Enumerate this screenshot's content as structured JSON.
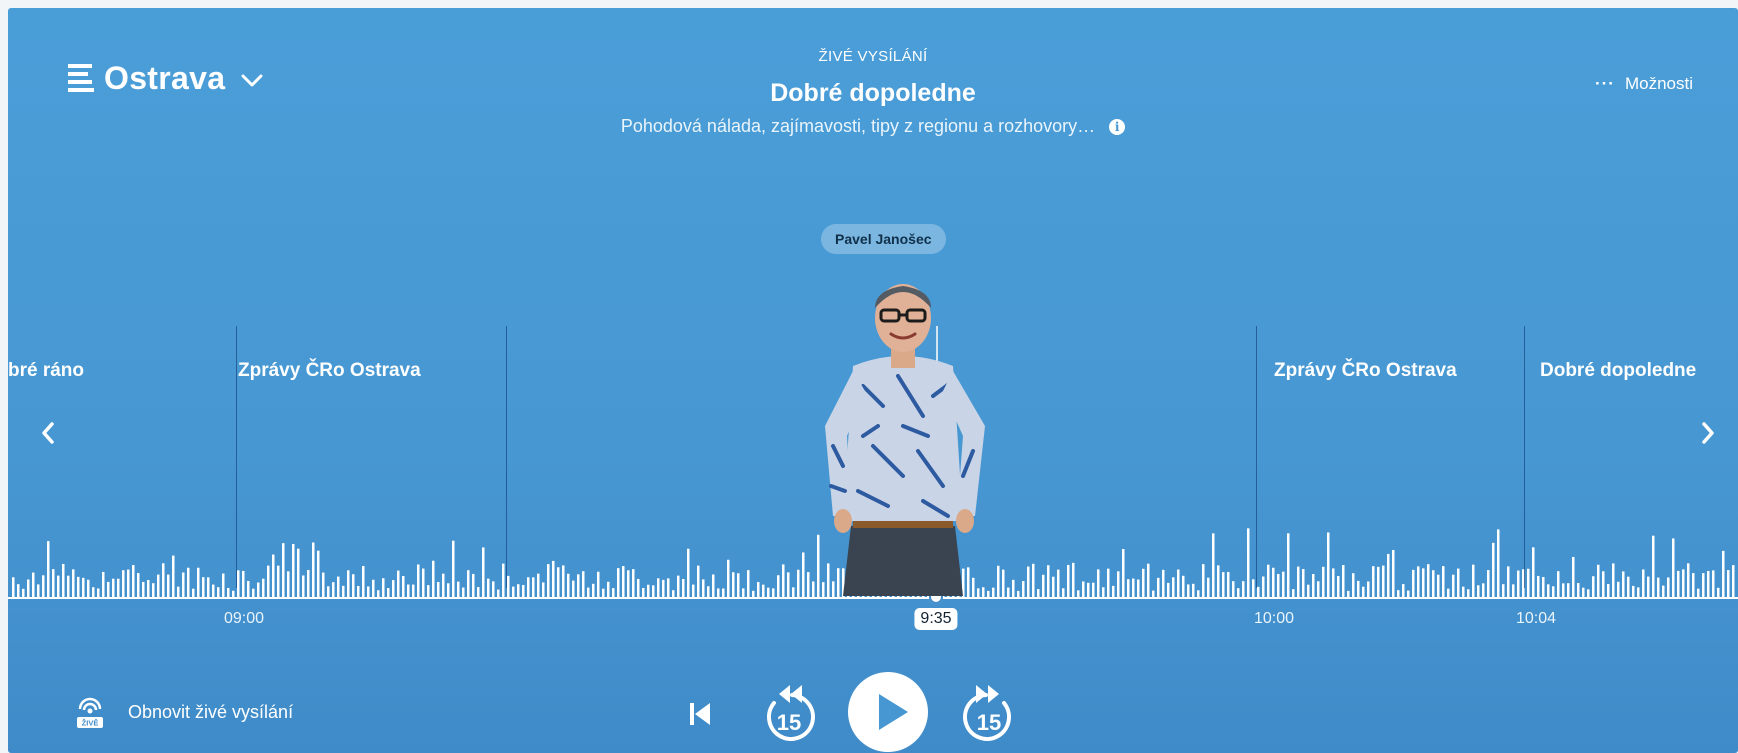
{
  "header": {
    "station_name": "Ostrava",
    "live_label": "ŽIVÉ VYSÍLÁNÍ",
    "show_title": "Dobré dopoledne",
    "show_description": "Pohodová nálada, zajímavosti, tipy z regionu a rozhovory…",
    "options_label": "Možnosti"
  },
  "host": {
    "name": "Pavel Janošec"
  },
  "timeline": {
    "segments": [
      "bré ráno",
      "Zprávy ČRo Ostrava",
      "Zprávy ČRo Ostrava",
      "Dobré dopoledne"
    ],
    "ticks": [
      "09:00",
      "10:00",
      "10:04"
    ],
    "current_time": "9:35"
  },
  "controls": {
    "restore_live_label": "Obnovit živé vysílání",
    "restore_live_badge": "ŽIVĚ",
    "rewind_seconds": "15",
    "forward_seconds": "15"
  },
  "colors": {
    "background": "#4797d2",
    "text": "#ffffff"
  }
}
